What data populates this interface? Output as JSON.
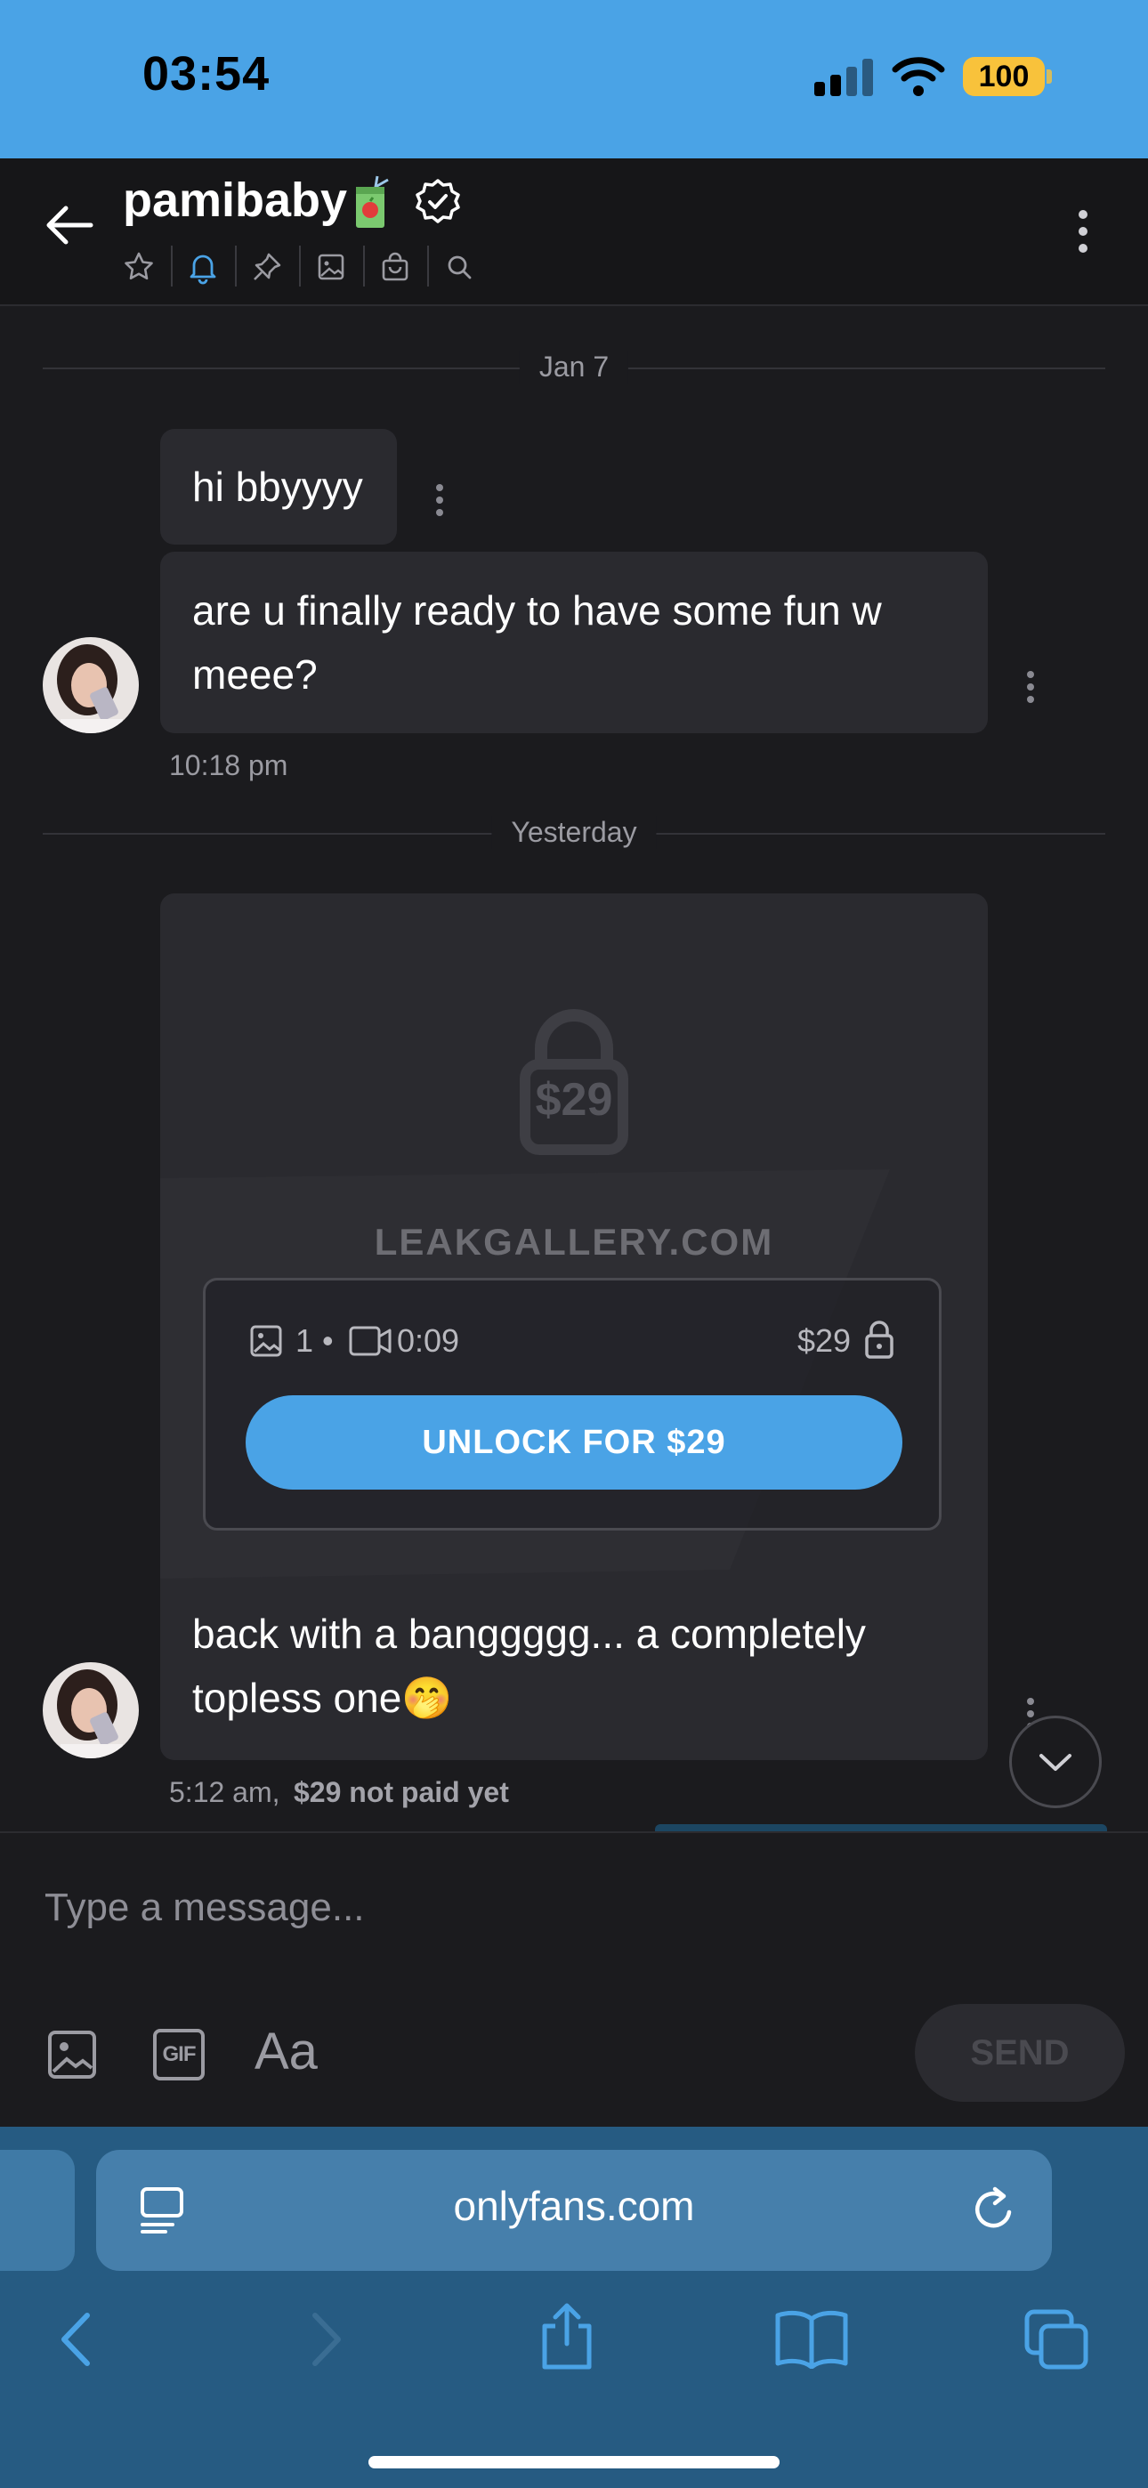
{
  "status_bar": {
    "time": "03:54",
    "battery": "100"
  },
  "chat_header": {
    "username": "pamibaby",
    "toolbar_icons": [
      "star-icon",
      "bell-icon",
      "pin-icon",
      "image-icon",
      "bag-icon",
      "search-icon"
    ],
    "accent_color": "#4aa3e6"
  },
  "conversation": {
    "date_separators": [
      "Jan 7",
      "Yesterday"
    ],
    "messages": [
      {
        "text": "hi bbyyyy"
      },
      {
        "text_line1": "are u finally ready to have some fun w",
        "text_line2": "meee?",
        "time": "10:18 pm"
      }
    ],
    "locked_post": {
      "price_badge": "$29",
      "watermark": "LEAKGALLERY.COM",
      "photo_count": "1",
      "separator": "•",
      "video_duration": "0:09",
      "price": "$29",
      "unlock_label": "UNLOCK FOR $29",
      "caption_line1": "back with a banggggg... a completely",
      "caption_line2": "topless one🤭",
      "time": "5:12 am,",
      "payment_status": "$29 not paid yet"
    }
  },
  "composer": {
    "placeholder": "Type a message...",
    "text_tool_label": "Aa",
    "gif_label": "GIF",
    "send_label": "SEND"
  },
  "browser": {
    "url": "onlyfans.com"
  }
}
